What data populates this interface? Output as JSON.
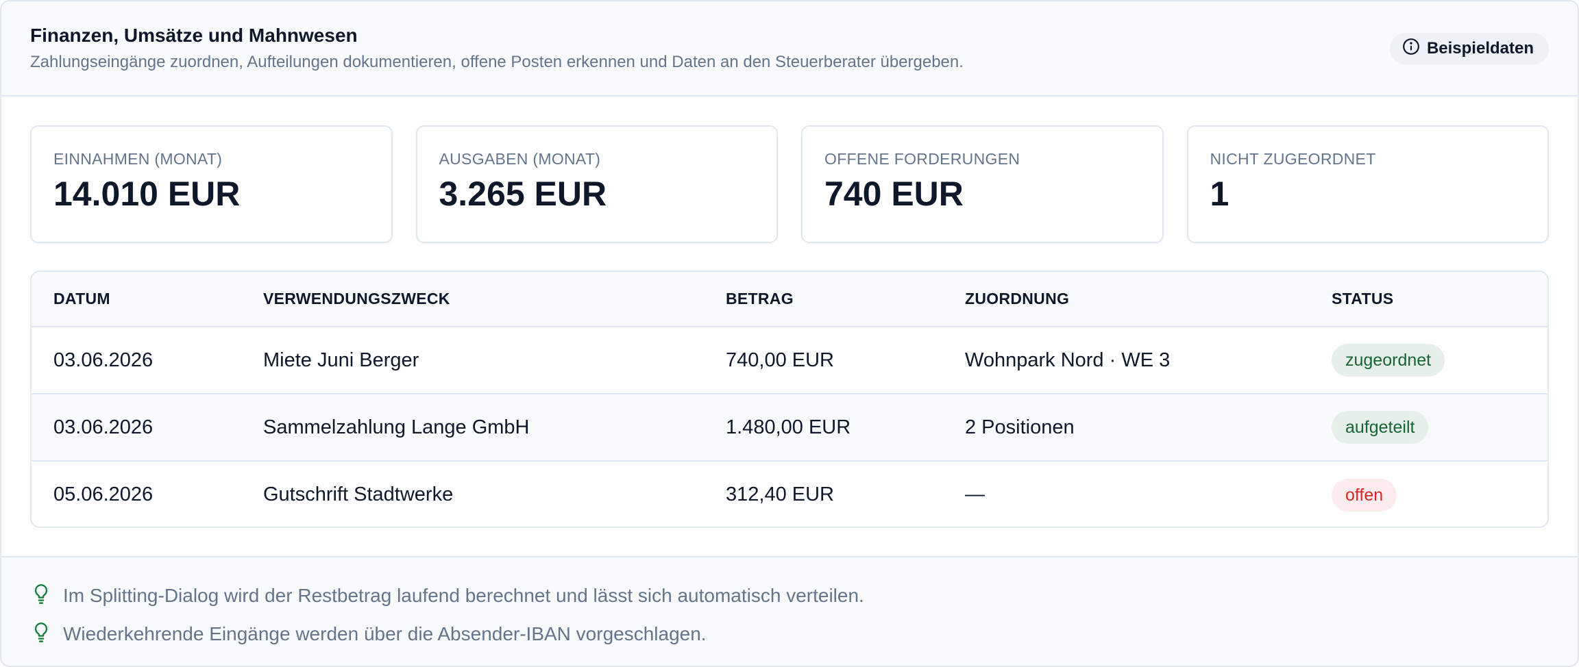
{
  "header": {
    "title": "Finanzen, Umsätze und Mahnwesen",
    "subtitle": "Zahlungseingänge zuordnen, Aufteilungen dokumentieren, offene Posten erkennen und Daten an den Steuerberater übergeben.",
    "badge_icon": "info-icon",
    "badge_label": "Beispieldaten"
  },
  "stats": [
    {
      "label": "EINNAHMEN (MONAT)",
      "value": "14.010 EUR"
    },
    {
      "label": "AUSGABEN (MONAT)",
      "value": "3.265 EUR"
    },
    {
      "label": "OFFENE FORDERUNGEN",
      "value": "740 EUR"
    },
    {
      "label": "NICHT ZUGEORDNET",
      "value": "1"
    }
  ],
  "table": {
    "columns": [
      "DATUM",
      "VERWENDUNGSZWECK",
      "BETRAG",
      "ZUORDNUNG",
      "STATUS"
    ],
    "rows": [
      {
        "date": "03.06.2026",
        "purpose": "Miete Juni Berger",
        "amount": "740,00 EUR",
        "assignment": "Wohnpark Nord · WE 3",
        "status": "zugeordnet"
      },
      {
        "date": "03.06.2026",
        "purpose": "Sammelzahlung Lange GmbH",
        "amount": "1.480,00 EUR",
        "assignment": "2 Positionen",
        "status": "aufgeteilt"
      },
      {
        "date": "05.06.2026",
        "purpose": "Gutschrift Stadtwerke",
        "amount": "312,40 EUR",
        "assignment": "—",
        "status": "offen"
      }
    ],
    "status_colors": {
      "zugeordnet": "#166534",
      "aufgeteilt": "#166534",
      "offen": "#dc2626"
    }
  },
  "tips": {
    "icon": "lightbulb-icon",
    "items": [
      "Im Splitting-Dialog wird der Restbetrag laufend berechnet und lässt sich automatisch verteilen.",
      "Wiederkehrende Eingänge werden über die Absender-IBAN vorgeschlagen."
    ]
  }
}
